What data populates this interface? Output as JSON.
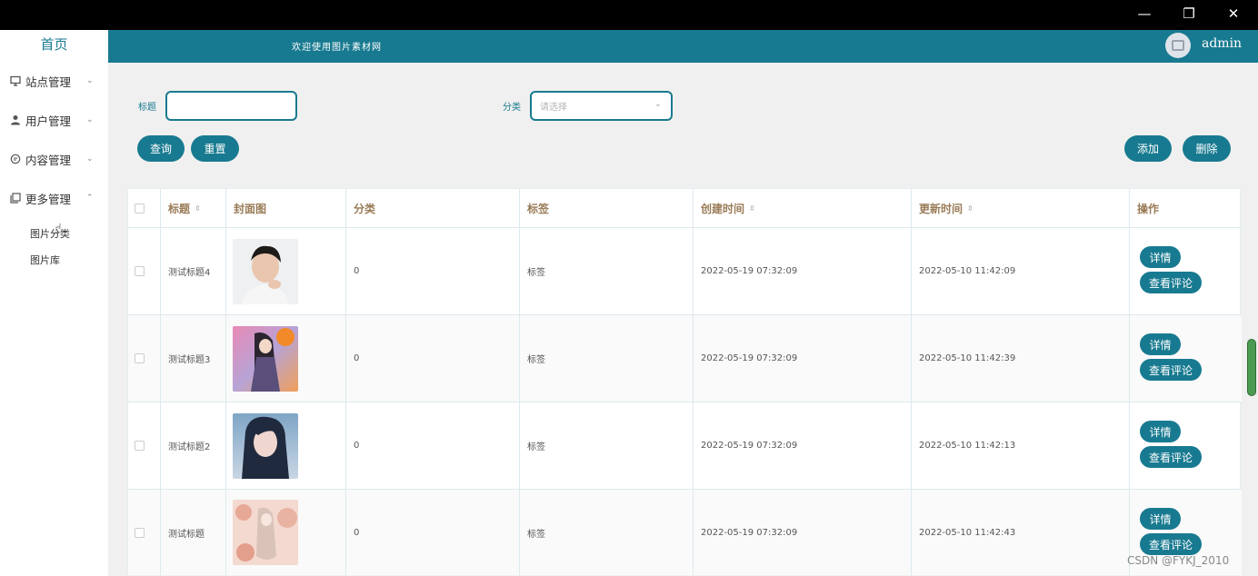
{
  "window": {
    "min": "—",
    "max": "❐",
    "close": "✕"
  },
  "sidebar": {
    "home": "首页",
    "items": [
      {
        "label": "站点管理",
        "icon": "monitor-icon"
      },
      {
        "label": "用户管理",
        "icon": "user-icon"
      },
      {
        "label": "内容管理",
        "icon": "chat-icon"
      },
      {
        "label": "更多管理",
        "icon": "copy-icon",
        "expanded": true
      }
    ],
    "subitems": [
      "图片分类",
      "图片库"
    ]
  },
  "header": {
    "welcome": "欢迎使用图片素材网",
    "user": "admin",
    "avatar_icon": "image-icon"
  },
  "search": {
    "title_label": "标题",
    "title_value": "",
    "category_label": "分类",
    "category_placeholder": "请选择",
    "query": "查询",
    "reset": "重置",
    "add": "添加",
    "delete": "删除"
  },
  "table": {
    "headers": [
      "标题",
      "封面图",
      "分类",
      "标签",
      "创建时间",
      "更新时间",
      "操作"
    ],
    "rows": [
      {
        "title": "测试标题4",
        "category": "0",
        "tag": "标签",
        "created": "2022-05-19 07:32:09",
        "updated": "2022-05-10 11:42:09",
        "cover": "portrait-young-man"
      },
      {
        "title": "测试标题3",
        "category": "0",
        "tag": "标签",
        "created": "2022-05-19 07:32:09",
        "updated": "2022-05-10 11:42:39",
        "cover": "anime-girl-colorful"
      },
      {
        "title": "测试标题2",
        "category": "0",
        "tag": "标签",
        "created": "2022-05-19 07:32:09",
        "updated": "2022-05-10 11:42:13",
        "cover": "portrait-young-woman"
      },
      {
        "title": "测试标题",
        "category": "0",
        "tag": "标签",
        "created": "2022-05-19 07:32:09",
        "updated": "2022-05-10 11:42:43",
        "cover": "anime-girl-blossom"
      }
    ],
    "actions": {
      "detail": "详情",
      "comments": "查看评论"
    }
  },
  "watermark": "CSDN @FYKJ_2010",
  "colors": {
    "primary": "#187a90",
    "header_text": "#9a7b57"
  }
}
